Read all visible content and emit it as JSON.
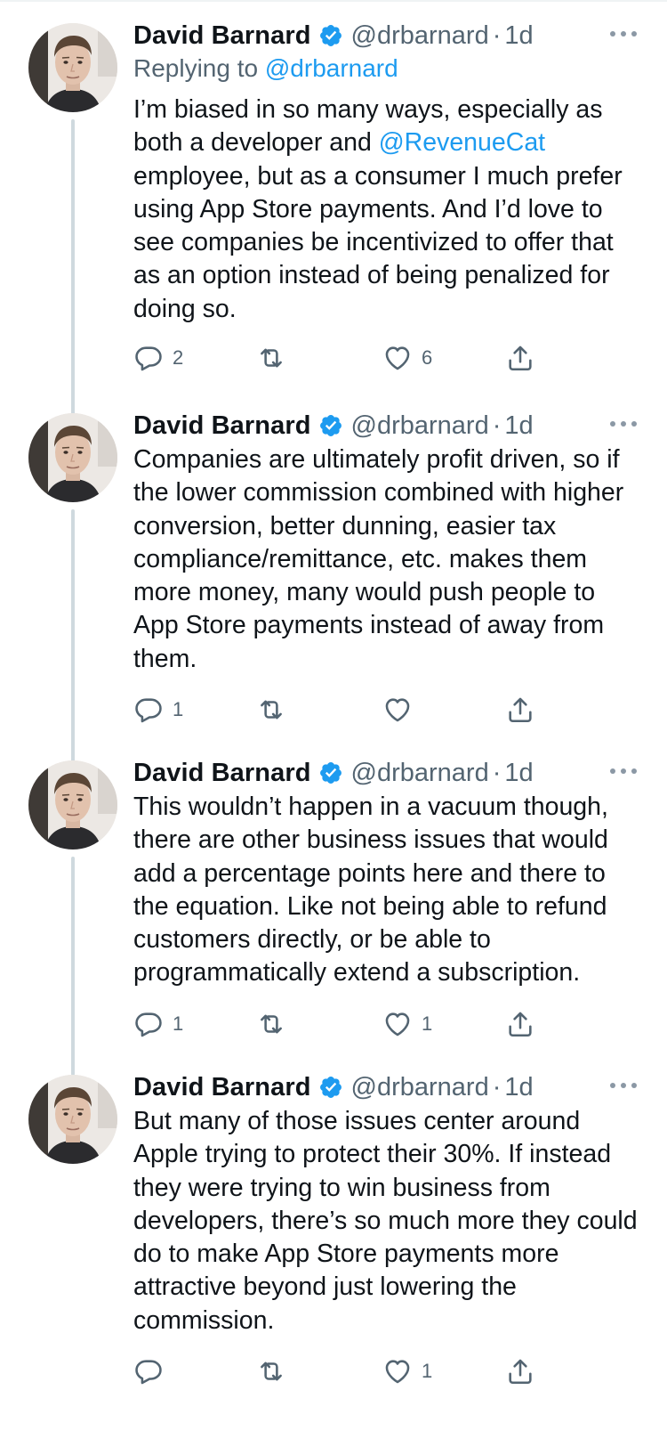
{
  "tweets": [
    {
      "author": {
        "name": "David Barnard",
        "handle": "@drbarnard",
        "verified": true
      },
      "time": "1d",
      "separator": "·",
      "replying_prefix": "Replying to",
      "replying_handle": "@drbarnard",
      "text_parts": [
        "I’m biased in so many ways, especially as both a developer and ",
        "@RevenueCat",
        " employee, but as a consumer I much prefer using App Store payments. And I’d love to see companies be incentivized to offer that as an option instead of being penalized for doing so."
      ],
      "stats": {
        "replies": "2",
        "retweets": "",
        "likes": "6"
      }
    },
    {
      "author": {
        "name": "David Barnard",
        "handle": "@drbarnard",
        "verified": true
      },
      "time": "1d",
      "separator": "·",
      "text": "Companies are ultimately profit driven, so if the lower commission combined with higher conversion, better dunning, easier tax compliance/remittance, etc. makes them more money, many would push people to App Store payments instead of away from them.",
      "stats": {
        "replies": "1",
        "retweets": "",
        "likes": ""
      }
    },
    {
      "author": {
        "name": "David Barnard",
        "handle": "@drbarnard",
        "verified": true
      },
      "time": "1d",
      "separator": "·",
      "text": "This wouldn’t happen in a vacuum though, there are other business issues that would add a percentage points here and there to the equation. Like not being able to refund customers directly, or be able to programmatically extend a subscription.",
      "stats": {
        "replies": "1",
        "retweets": "",
        "likes": "1"
      }
    },
    {
      "author": {
        "name": "David Barnard",
        "handle": "@drbarnard",
        "verified": true
      },
      "time": "1d",
      "separator": "·",
      "text": "But many of those issues center around Apple trying to protect their 30%. If instead they were trying to win business from developers, there’s so much more they could do to make App Store payments more attractive beyond just lowering the commission.",
      "stats": {
        "replies": "",
        "retweets": "",
        "likes": "1"
      }
    }
  ],
  "icons": {
    "verified": "verified-badge-icon",
    "more": "more-horizontal-icon",
    "reply": "reply-icon",
    "retweet": "retweet-icon",
    "like": "heart-icon",
    "share": "share-icon"
  },
  "colors": {
    "text": "#0f1419",
    "secondary": "#536471",
    "accent": "#1d9bf0",
    "thread_line": "#cfd9de"
  }
}
